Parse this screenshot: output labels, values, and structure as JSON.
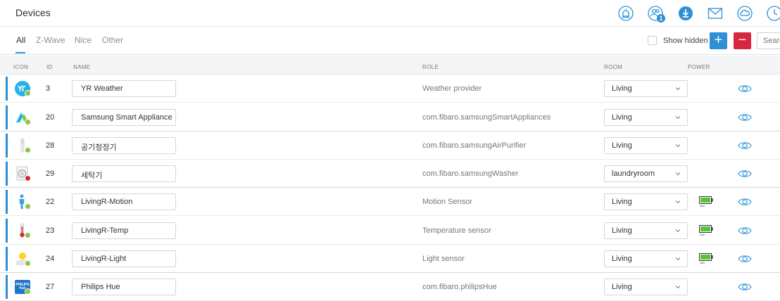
{
  "header": {
    "title": "Devices",
    "icons": [
      "alarm-icon",
      "users-icon",
      "download-icon",
      "mail-icon",
      "cloud-icon",
      "clock-icon"
    ],
    "users_badge": "1",
    "accent": "#2d8fd5"
  },
  "tabs": [
    {
      "label": "All",
      "active": true
    },
    {
      "label": "Z-Wave",
      "active": false
    },
    {
      "label": "Nice",
      "active": false
    },
    {
      "label": "Other",
      "active": false
    }
  ],
  "toolbar": {
    "show_hidden_label": "Show hidden",
    "add_label": "+",
    "remove_label": "−",
    "search_placeholder": "Search"
  },
  "columns": {
    "icon": "ICON",
    "id": "ID",
    "name": "NAME",
    "role": "ROLE",
    "room": "ROOM",
    "power": "POWER"
  },
  "devices": [
    {
      "id": "3",
      "name": "YR Weather",
      "role": "Weather provider",
      "room": "Living",
      "icon": "yr-weather-icon",
      "status": "ok",
      "battery": false
    },
    {
      "id": "20",
      "name": "Samsung Smart Appliance",
      "role": "com.fibaro.samsungSmartAppliances",
      "room": "Living",
      "icon": "samsung-appliance-icon",
      "status": "ok",
      "battery": false
    },
    {
      "id": "28",
      "name": "공기청정기",
      "role": "com.fibaro.samsungAirPurifier",
      "room": "Living",
      "icon": "air-purifier-icon",
      "status": "ok",
      "battery": false
    },
    {
      "id": "29",
      "name": "세탁기",
      "role": "com.fibaro.samsungWasher",
      "room": "laundryroom",
      "icon": "washer-icon",
      "status": "error",
      "battery": false
    },
    {
      "id": "22",
      "name": "LivingR-Motion",
      "role": "Motion Sensor",
      "room": "Living",
      "icon": "motion-sensor-icon",
      "status": "ok",
      "battery": true,
      "battery_level": "100"
    },
    {
      "id": "23",
      "name": "LivingR-Temp",
      "role": "Temperature sensor",
      "room": "Living",
      "icon": "thermometer-icon",
      "status": "ok",
      "battery": true,
      "battery_level": "100"
    },
    {
      "id": "24",
      "name": "LivingR-Light",
      "role": "Light sensor",
      "room": "Living",
      "icon": "light-sensor-icon",
      "status": "ok",
      "battery": true,
      "battery_level": "100"
    },
    {
      "id": "27",
      "name": "Philips Hue",
      "role": "com.fibaro.philipsHue",
      "room": "Living",
      "icon": "philips-hue-icon",
      "icon_text": "PHILIPS hue",
      "status": "ok",
      "battery": false
    }
  ]
}
